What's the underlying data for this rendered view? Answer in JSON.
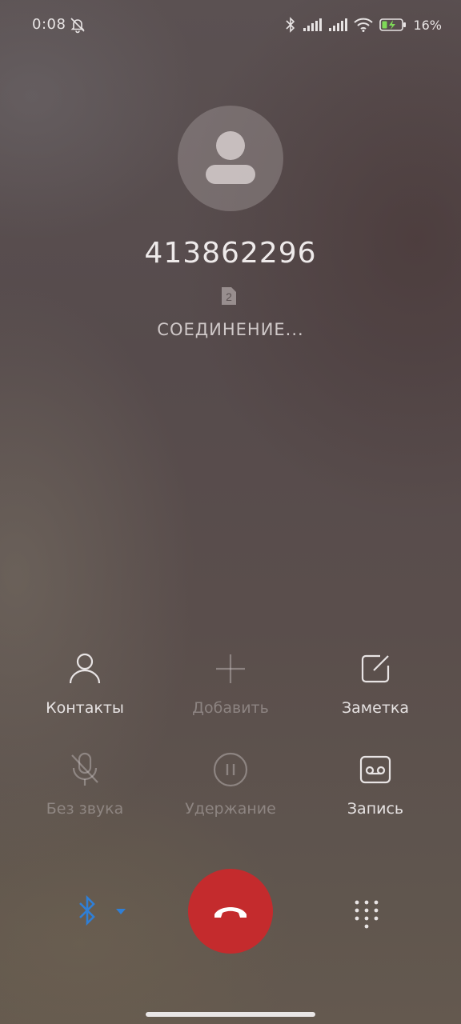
{
  "status_bar": {
    "time": "0:08",
    "battery_percent": "16%",
    "icons": [
      "alarm-off-icon",
      "bluetooth-icon",
      "signal-1-icon",
      "signal-2-icon",
      "wifi-icon",
      "battery-charging-icon"
    ]
  },
  "caller": {
    "number": "413862296",
    "sim_slot": "2",
    "status": "СОЕДИНЕНИЕ..."
  },
  "controls": [
    {
      "label": "Контакты",
      "icon": "person-icon",
      "enabled": true
    },
    {
      "label": "Добавить",
      "icon": "plus-icon",
      "enabled": false
    },
    {
      "label": "Заметка",
      "icon": "note-icon",
      "enabled": true
    },
    {
      "label": "Без звука",
      "icon": "mic-off-icon",
      "enabled": false
    },
    {
      "label": "Удержание",
      "icon": "pause-icon",
      "enabled": false
    },
    {
      "label": "Запись",
      "icon": "record-icon",
      "enabled": true
    }
  ],
  "bottom_actions": {
    "audio_route": "bluetooth-icon",
    "end_call": "end-call-icon",
    "keypad": "dialpad-icon"
  },
  "colors": {
    "end_call": "#c42b2d",
    "bluetooth_accent": "#2f7fd6",
    "battery_charge": "#7ed957"
  }
}
